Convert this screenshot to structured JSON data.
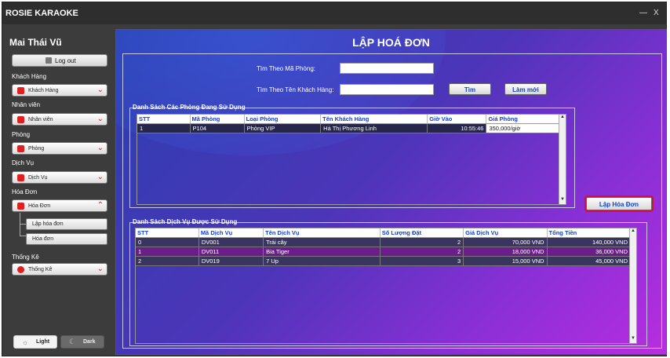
{
  "app": {
    "title": "ROSIE KARAOKE",
    "minimize": "—",
    "close": "X"
  },
  "sidebar": {
    "user": "Mai Thái Vũ",
    "logout": "Log out",
    "sections": [
      {
        "label": "Khách Hàng",
        "combo": "Khách Hàng",
        "icon": "customer-icon"
      },
      {
        "label": "Nhân viên",
        "combo": "Nhân viên",
        "icon": "staff-icon"
      },
      {
        "label": "Phòng",
        "combo": "Phòng",
        "icon": "room-icon"
      },
      {
        "label": "Dịch Vụ",
        "combo": "Dịch Vụ",
        "icon": "service-icon"
      },
      {
        "label": "Hóa Đơn",
        "combo": "Hóa Đơn",
        "icon": "invoice-icon"
      },
      {
        "label": "Thống Kê",
        "combo": "Thống Kê",
        "icon": "chart-icon"
      }
    ],
    "invoice_sub": [
      "Lập hóa đơn",
      "Hóa đơn"
    ],
    "theme_light": "Light",
    "theme_dark": "Dark"
  },
  "main": {
    "title": "LẬP HOÁ ĐƠN",
    "search_room_label": "Tìm Theo Mã Phòng:",
    "search_customer_label": "Tìm Theo Tên Khách Hàng:",
    "search_room_value": "",
    "search_customer_value": "",
    "btn_search": "Tìm",
    "btn_refresh": "Làm mới",
    "btn_create": "Lập Hóa Đơn",
    "rooms_group": "Danh Sách Các Phòng Đang Sử Dụng",
    "rooms_columns": [
      "STT",
      "Mã Phòng",
      "Loại Phòng",
      "Tên Khách Hàng",
      "Giờ Vào",
      "Giá Phòng"
    ],
    "rooms_rows": [
      [
        "1",
        "P104",
        "Phòng VIP",
        "Hà Thị Phương Linh",
        "10:55:46",
        "350,000/giờ"
      ]
    ],
    "services_group": "Danh Sách Dịch Vụ Được Sử Dụng",
    "services_columns": [
      "STT",
      "Mã Dịch Vụ",
      "Tên Dịch Vụ",
      "Số Lượng Đặt",
      "Giá Dịch Vụ",
      "Tổng Tiền"
    ],
    "services_rows": [
      [
        "0",
        "DV001",
        "Trái cây",
        "2",
        "70,000 VND",
        "140,000 VND"
      ],
      [
        "1",
        "DV011",
        "Bia Tiger",
        "2",
        "18,000 VND",
        "36,000 VND"
      ],
      [
        "2",
        "DV019",
        "7 Up",
        "3",
        "15,000 VND",
        "45,000 VND"
      ]
    ]
  },
  "colors": {
    "accent": "#1340d0",
    "highlight": "#d0103a"
  }
}
